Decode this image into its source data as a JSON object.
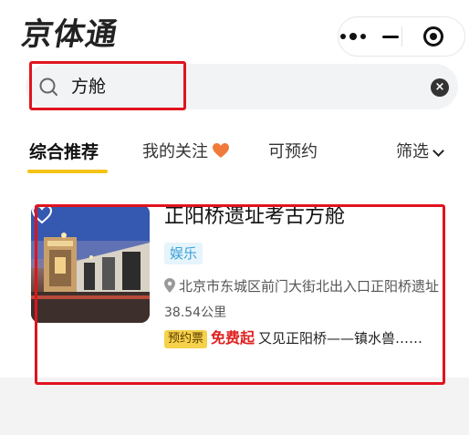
{
  "app": {
    "logo": "京体通"
  },
  "search": {
    "query": "方舱"
  },
  "tabs": [
    {
      "label": "综合推荐"
    },
    {
      "label": "我的关注"
    },
    {
      "label": "可预约"
    }
  ],
  "filter": {
    "label": "筛选"
  },
  "results": [
    {
      "title": "正阳桥遗址考古方舱",
      "tag": "娱乐",
      "address": "北京市东城区前门大街北出入口正阳桥遗址",
      "distance": "38.54公里",
      "badge": "预约票",
      "price": "免费起",
      "desc": "又见正阳桥——镇水兽……"
    }
  ],
  "colors": {
    "accent_yellow": "#f4c316",
    "tag_blue": "#3aa0d8",
    "price_red": "#e02020",
    "highlight_red": "#e0141e",
    "heart_orange": "#f07a3a"
  }
}
